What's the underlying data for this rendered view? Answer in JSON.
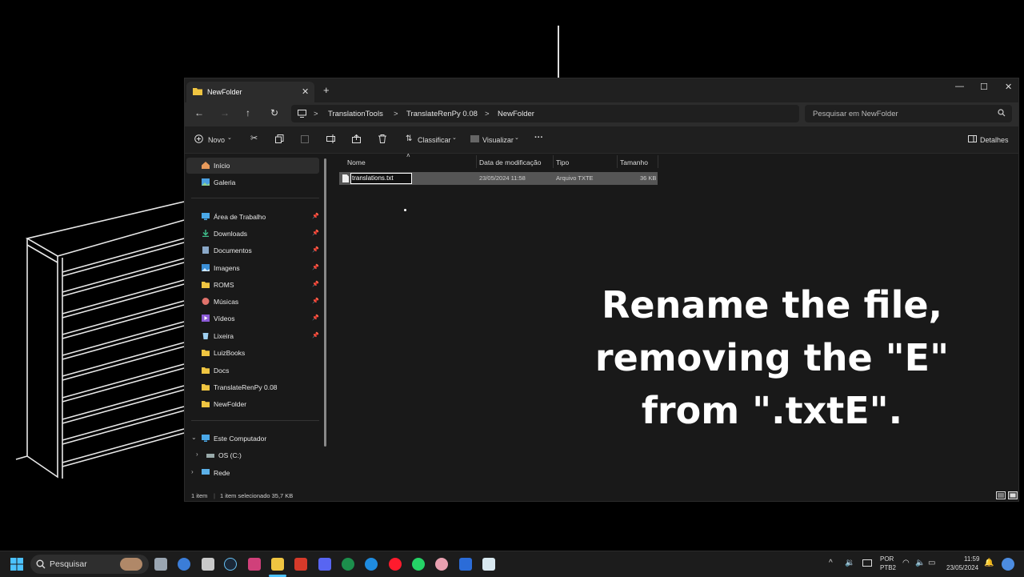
{
  "window": {
    "tab_title": "NewFolder",
    "close_tab": "✕",
    "new_tab": "+",
    "minimize": "—",
    "maximize": "☐",
    "close": "✕"
  },
  "address": {
    "crumbs": [
      "TranslationTools",
      "TranslateRenPy 0.08",
      "NewFolder"
    ],
    "separator": ">",
    "search_placeholder": "Pesquisar em NewFolder"
  },
  "toolbar": {
    "new_label": "Novo",
    "sort_label": "Classificar",
    "view_label": "Visualizar",
    "more_label": "···",
    "details_label": "Detalhes"
  },
  "sidebar": {
    "items": [
      {
        "label": "Início",
        "icon": "home-icon"
      },
      {
        "label": "Galeria",
        "icon": "gallery-icon"
      },
      {
        "label": "Área de Trabalho",
        "icon": "desktop-icon"
      },
      {
        "label": "Downloads",
        "icon": "download-icon"
      },
      {
        "label": "Documentos",
        "icon": "document-icon"
      },
      {
        "label": "Imagens",
        "icon": "pictures-icon"
      },
      {
        "label": "ROMS",
        "icon": "folder-icon"
      },
      {
        "label": "Músicas",
        "icon": "music-icon"
      },
      {
        "label": "Vídeos",
        "icon": "video-icon"
      },
      {
        "label": "Lixeira",
        "icon": "recycle-bin-icon"
      },
      {
        "label": "LuizBooks",
        "icon": "folder-icon"
      },
      {
        "label": "Docs",
        "icon": "folder-icon"
      },
      {
        "label": "TranslateRenPy 0.08",
        "icon": "folder-icon"
      },
      {
        "label": "NewFolder",
        "icon": "folder-icon"
      },
      {
        "label": "Este Computador",
        "icon": "computer-icon"
      },
      {
        "label": "OS (C:)",
        "icon": "drive-icon"
      },
      {
        "label": "Rede",
        "icon": "network-icon"
      }
    ]
  },
  "columns": {
    "name": "Nome",
    "modified": "Data de modificação",
    "type": "Tipo",
    "size": "Tamanho"
  },
  "files": [
    {
      "name": "translations.txt",
      "modified": "23/05/2024 11:58",
      "type": "Arquivo TXTE",
      "size": "36 KB"
    }
  ],
  "status": {
    "count": "1 item",
    "selected": "1 item selecionado  35,7 KB"
  },
  "overlay": {
    "lines": [
      "Rename the file,",
      "removing the \"E\"",
      "from \".txtE\"."
    ]
  },
  "taskbar": {
    "search_label": "Pesquisar",
    "lang_top": "POR",
    "lang_bottom": "PTB2",
    "time": "11:59",
    "date": "23/05/2024"
  },
  "colors": {
    "accent": "#f0c541",
    "background": "#000000",
    "window": "#191919"
  }
}
